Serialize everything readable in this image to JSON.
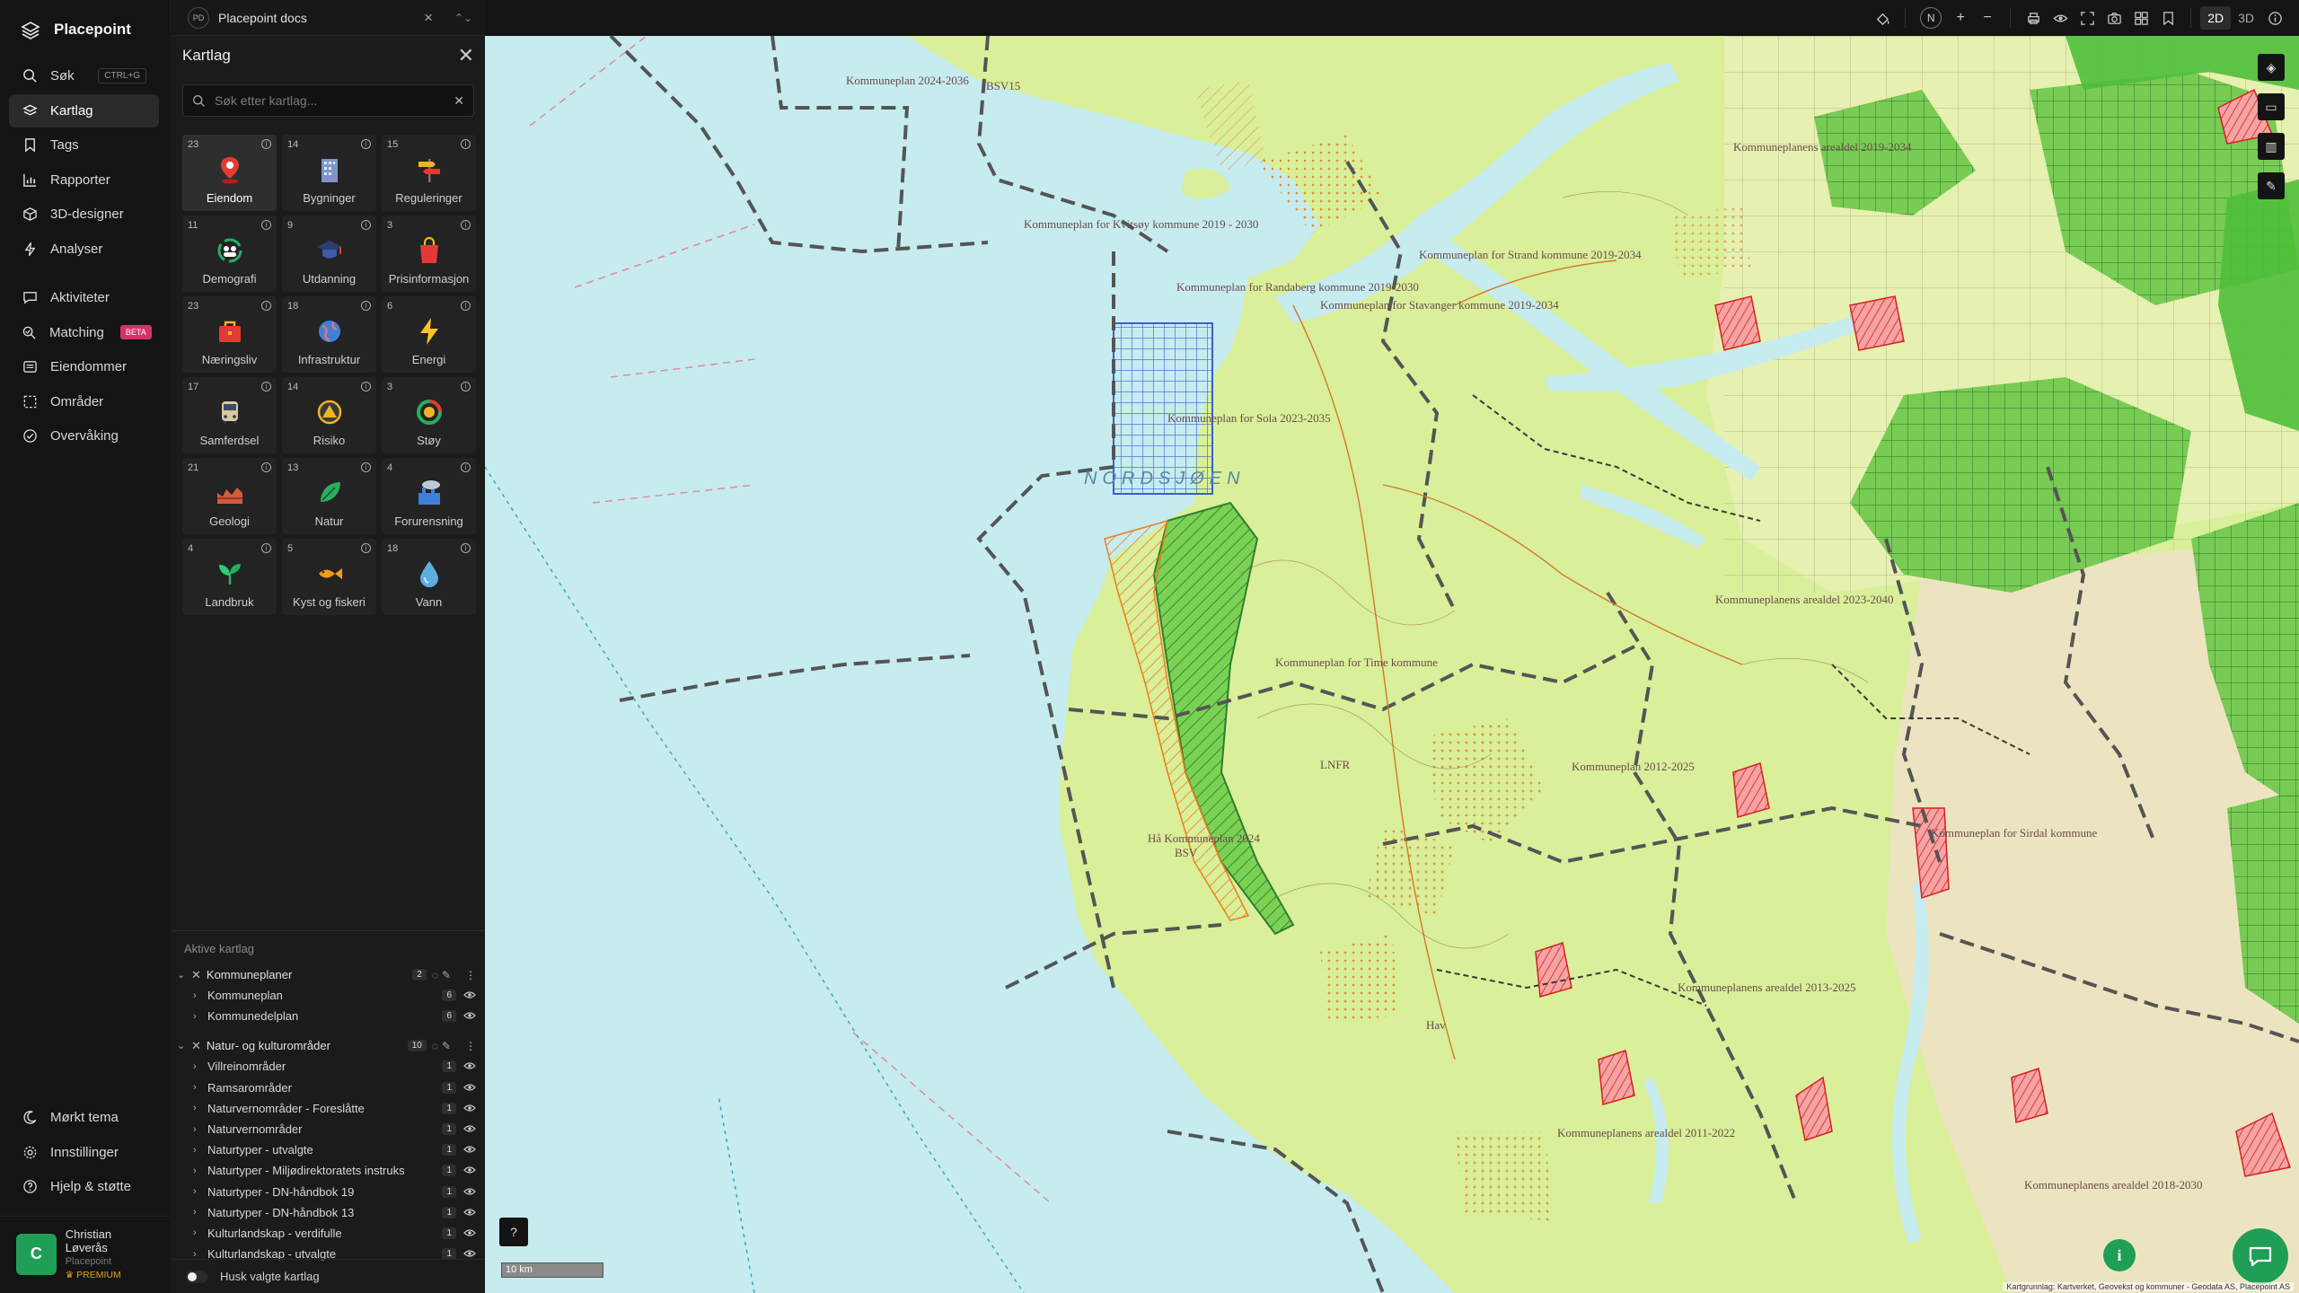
{
  "app": {
    "name": "Placepoint"
  },
  "nav": {
    "items": [
      {
        "label": "Søk",
        "shortcut": "CTRL+G",
        "icon": "search-icon"
      },
      {
        "label": "Kartlag",
        "icon": "layers-icon",
        "active": true
      },
      {
        "label": "Tags",
        "icon": "bookmark-icon"
      },
      {
        "label": "Rapporter",
        "icon": "bar-chart-icon"
      },
      {
        "label": "3D-designer",
        "icon": "cube-icon"
      },
      {
        "label": "Analyser",
        "icon": "lightning-icon"
      }
    ],
    "items2": [
      {
        "label": "Aktiviteter",
        "icon": "chat-icon"
      },
      {
        "label": "Matching",
        "badge": "BETA",
        "icon": "match-icon"
      },
      {
        "label": "Eiendommer",
        "icon": "list-icon"
      },
      {
        "label": "Områder",
        "icon": "area-icon"
      },
      {
        "label": "Overvåking",
        "icon": "monitor-icon"
      }
    ],
    "bottom": [
      {
        "label": "Mørkt tema",
        "icon": "moon-icon"
      },
      {
        "label": "Innstillinger",
        "icon": "gear-icon"
      },
      {
        "label": "Hjelp & støtte",
        "icon": "help-icon"
      }
    ],
    "user": {
      "initial": "C",
      "name": "Christian Løverås",
      "org": "Placepoint",
      "plan": "PREMIUM"
    }
  },
  "panel": {
    "doc_tab": {
      "badge": "PD",
      "title": "Placepoint docs"
    },
    "title": "Kartlag",
    "search_placeholder": "Søk etter kartlag...",
    "categories": [
      {
        "count": "23",
        "label": "Eiendom",
        "icon": "pin-icon",
        "selected": true
      },
      {
        "count": "14",
        "label": "Bygninger",
        "icon": "building-icon"
      },
      {
        "count": "15",
        "label": "Reguleringer",
        "icon": "signpost-icon"
      },
      {
        "count": "11",
        "label": "Demografi",
        "icon": "people-icon"
      },
      {
        "count": "9",
        "label": "Utdanning",
        "icon": "graduation-icon"
      },
      {
        "count": "3",
        "label": "Prisinformasjon",
        "icon": "shopping-bag-icon"
      },
      {
        "count": "23",
        "label": "Næringsliv",
        "icon": "briefcase-icon"
      },
      {
        "count": "18",
        "label": "Infrastruktur",
        "icon": "globe-icon"
      },
      {
        "count": "6",
        "label": "Energi",
        "icon": "lightning-icon"
      },
      {
        "count": "17",
        "label": "Samferdsel",
        "icon": "bus-icon"
      },
      {
        "count": "14",
        "label": "Risiko",
        "icon": "warning-icon"
      },
      {
        "count": "3",
        "label": "Støy",
        "icon": "noise-icon"
      },
      {
        "count": "21",
        "label": "Geologi",
        "icon": "terrain-icon"
      },
      {
        "count": "13",
        "label": "Natur",
        "icon": "leaf-icon"
      },
      {
        "count": "4",
        "label": "Forurensning",
        "icon": "factory-icon"
      },
      {
        "count": "4",
        "label": "Landbruk",
        "icon": "sprout-icon"
      },
      {
        "count": "5",
        "label": "Kyst og fiskeri",
        "icon": "fish-icon"
      },
      {
        "count": "18",
        "label": "Vann",
        "icon": "water-drop-icon"
      }
    ],
    "active_title": "Aktive kartlag",
    "groups": [
      {
        "name": "Kommuneplaner",
        "count": "2",
        "layers": [
          {
            "name": "Kommuneplan",
            "count": "6"
          },
          {
            "name": "Kommunedelplan",
            "count": "6"
          }
        ]
      },
      {
        "name": "Natur- og kulturområder",
        "count": "10",
        "layers": [
          {
            "name": "Villreinområder",
            "count": "1"
          },
          {
            "name": "Ramsarområder",
            "count": "1"
          },
          {
            "name": "Naturvernområder - Foreslåtte",
            "count": "1"
          },
          {
            "name": "Naturvernområder",
            "count": "1"
          },
          {
            "name": "Naturtyper - utvalgte",
            "count": "1"
          },
          {
            "name": "Naturtyper - Miljødirektoratets instruks",
            "count": "1"
          },
          {
            "name": "Naturtyper - DN-håndbok 19",
            "count": "1"
          },
          {
            "name": "Naturtyper - DN-håndbok 13",
            "count": "1"
          },
          {
            "name": "Kulturlandskap - verdifulle",
            "count": "1"
          },
          {
            "name": "Kulturlandskap - utvalgte",
            "count": "1"
          }
        ]
      }
    ],
    "remember_label": "Husk valgte kartlag"
  },
  "toolbar": {
    "compass": "N",
    "mode_2d": "2D",
    "mode_3d": "3D"
  },
  "map": {
    "sea_label": "NORDSJØEN",
    "labels": [
      "Kommuneplan 2024-2036",
      "BSV15",
      "Kommuneplan for Kvitsøy kommune 2019 - 2030",
      "Kommuneplan for Randaberg kommune 2019-2030",
      "Kommuneplan for Stavanger kommune 2019-2034",
      "Kommuneplan for Strand kommune 2019-2034",
      "Kommuneplan for Sola 2023-2035",
      "Kommuneplan for Time kommune",
      "Hå Kommuneplan 2024",
      "BSV",
      "LNFR",
      "Kommuneplanens arealdel 2023-2040",
      "Kommuneplanens arealdel 2019-2034",
      "Kommuneplan 2012-2025",
      "Kommuneplan for Sirdal kommune",
      "Kommuneplanens arealdel 2013-2025",
      "Kommuneplanens arealdel 2011-2022",
      "Kommuneplanens arealdel 2018-2030",
      "Hav"
    ],
    "scale_label": "10 km",
    "attribution": "Kartgrunnlag: Kartverket, Geovekst og kommuner - Geodata AS, Placepoint AS",
    "colors": {
      "sea": "#c6ecf0",
      "land": "#d9ef9a",
      "protected": "#4fbf3a",
      "boundary": "#555555",
      "accent": "#1f9e55"
    }
  }
}
